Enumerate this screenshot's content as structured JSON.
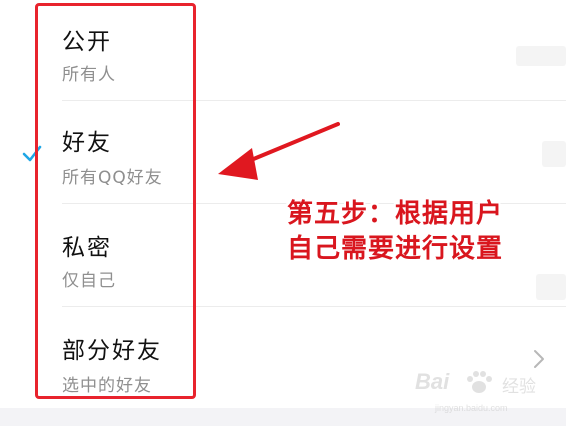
{
  "options": [
    {
      "title": "公开",
      "subtitle": "所有人",
      "selected": false
    },
    {
      "title": "好友",
      "subtitle": "所有QQ好友",
      "selected": true
    },
    {
      "title": "私密",
      "subtitle": "仅自己",
      "selected": false
    },
    {
      "title": "部分好友",
      "subtitle": "选中的好友",
      "selected": false
    }
  ],
  "annotation": {
    "line1": "第五步：根据用户",
    "line2": "自己需要进行设置",
    "color": "#d9161e"
  },
  "icons": {
    "selected_check": "checkmark-icon",
    "more": "chevron-right-icon"
  },
  "watermark": {
    "brand_text": "Bai",
    "brand_cn": "经验",
    "url": "jingyan.baidu.com"
  },
  "colors": {
    "accent": "#1fa6e6",
    "highlight": "#e8232d"
  }
}
